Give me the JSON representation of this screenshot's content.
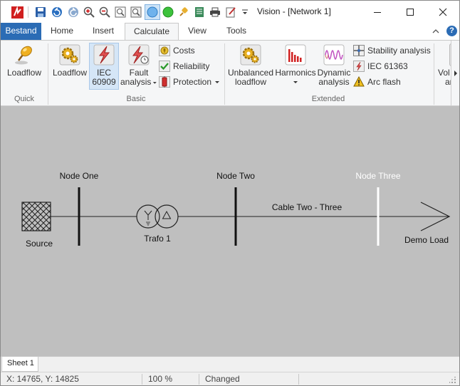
{
  "window": {
    "title": "Vision - [Network 1]",
    "controls": {
      "minimize": "–",
      "maximize": "☐",
      "close": "✕"
    }
  },
  "ribbon_tabs": [
    {
      "label": "Bestand",
      "active": false
    },
    {
      "label": "Home",
      "active": false
    },
    {
      "label": "Insert",
      "active": false
    },
    {
      "label": "Calculate",
      "active": true
    },
    {
      "label": "View",
      "active": false
    },
    {
      "label": "Tools",
      "active": false
    }
  ],
  "ribbon": {
    "quick": {
      "label": "Quick",
      "loadflow": "Loadflow"
    },
    "basic": {
      "label": "Basic",
      "loadflow": "Loadflow",
      "iec_line1": "IEC",
      "iec_line2": "60909",
      "fault_line1": "Fault",
      "fault_line2": "analysis",
      "costs": "Costs",
      "reliability": "Reliability",
      "protection": "Protection"
    },
    "extended": {
      "label": "Extended",
      "unbalanced_line1": "Unbalanced",
      "unbalanced_line2": "loadflow",
      "harmonics": "Harmonics",
      "dynamic_line1": "Dynamic",
      "dynamic_line2": "analysis",
      "stability": "Stability analysis",
      "iec61363": "IEC 61363",
      "arcflash": "Arc flash"
    },
    "overflow_line1": "Vol",
    "overflow_line2": "ar"
  },
  "network": {
    "source": "Source",
    "node_one": "Node One",
    "node_two": "Node Two",
    "node_three": "Node Three",
    "trafo": "Trafo 1",
    "cable": "Cable Two - Three",
    "load": "Demo Load"
  },
  "sheet_tab": "Sheet 1",
  "status": {
    "coords": "X: 14765, Y: 14825",
    "zoom": "100 %",
    "state": "Changed"
  },
  "colors": {
    "file_tab": "#2b6cb5",
    "canvas": "#bfbfbf",
    "ribbon": "#f5f6f7",
    "selected_node": "#ffffff"
  }
}
